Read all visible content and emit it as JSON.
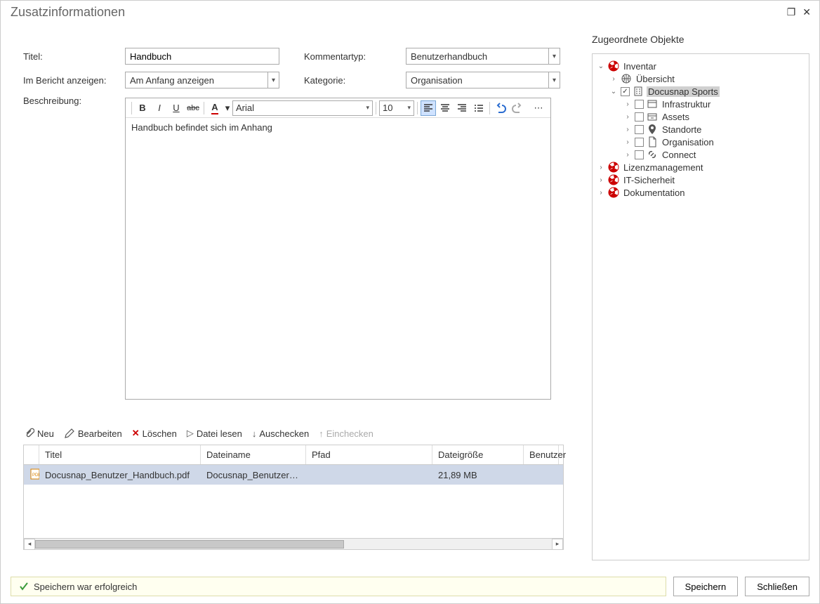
{
  "window": {
    "title": "Zusatzinformationen"
  },
  "form": {
    "titel_label": "Titel:",
    "titel_value": "Handbuch",
    "bericht_label": "Im Bericht anzeigen:",
    "bericht_value": "Am Anfang anzeigen",
    "kommentar_label": "Kommentartyp:",
    "kommentar_value": "Benutzerhandbuch",
    "kategorie_label": "Kategorie:",
    "kategorie_value": "Organisation",
    "beschreibung_label": "Beschreibung:",
    "editor_font": "Arial",
    "editor_size": "10",
    "editor_text": "Handbuch befindet sich im Anhang"
  },
  "attach_actions": {
    "neu": "Neu",
    "bearbeiten": "Bearbeiten",
    "loeschen": "Löschen",
    "datei_lesen": "Datei lesen",
    "auschecken": "Auschecken",
    "einchecken": "Einchecken"
  },
  "grid": {
    "headers": {
      "titel": "Titel",
      "dateiname": "Dateiname",
      "pfad": "Pfad",
      "dateigroesse": "Dateigröße",
      "benutzer": "Benutzer"
    },
    "rows": [
      {
        "titel": "Docusnap_Benutzer_Handbuch.pdf",
        "dateiname": "Docusnap_Benutzer_...",
        "pfad": "",
        "dateigroesse": "21,89 MB",
        "benutzer": ""
      }
    ]
  },
  "right": {
    "title": "Zugeordnete Objekte",
    "tree": {
      "inventar": "Inventar",
      "uebersicht": "Übersicht",
      "docusnap_sports": "Docusnap Sports",
      "infrastruktur": "Infrastruktur",
      "assets": "Assets",
      "standorte": "Standorte",
      "organisation": "Organisation",
      "connect": "Connect",
      "lizenz": "Lizenzmanagement",
      "sicherheit": "IT-Sicherheit",
      "doku": "Dokumentation"
    }
  },
  "status": {
    "text": "Speichern war erfolgreich"
  },
  "buttons": {
    "speichern": "Speichern",
    "schliessen": "Schließen"
  }
}
